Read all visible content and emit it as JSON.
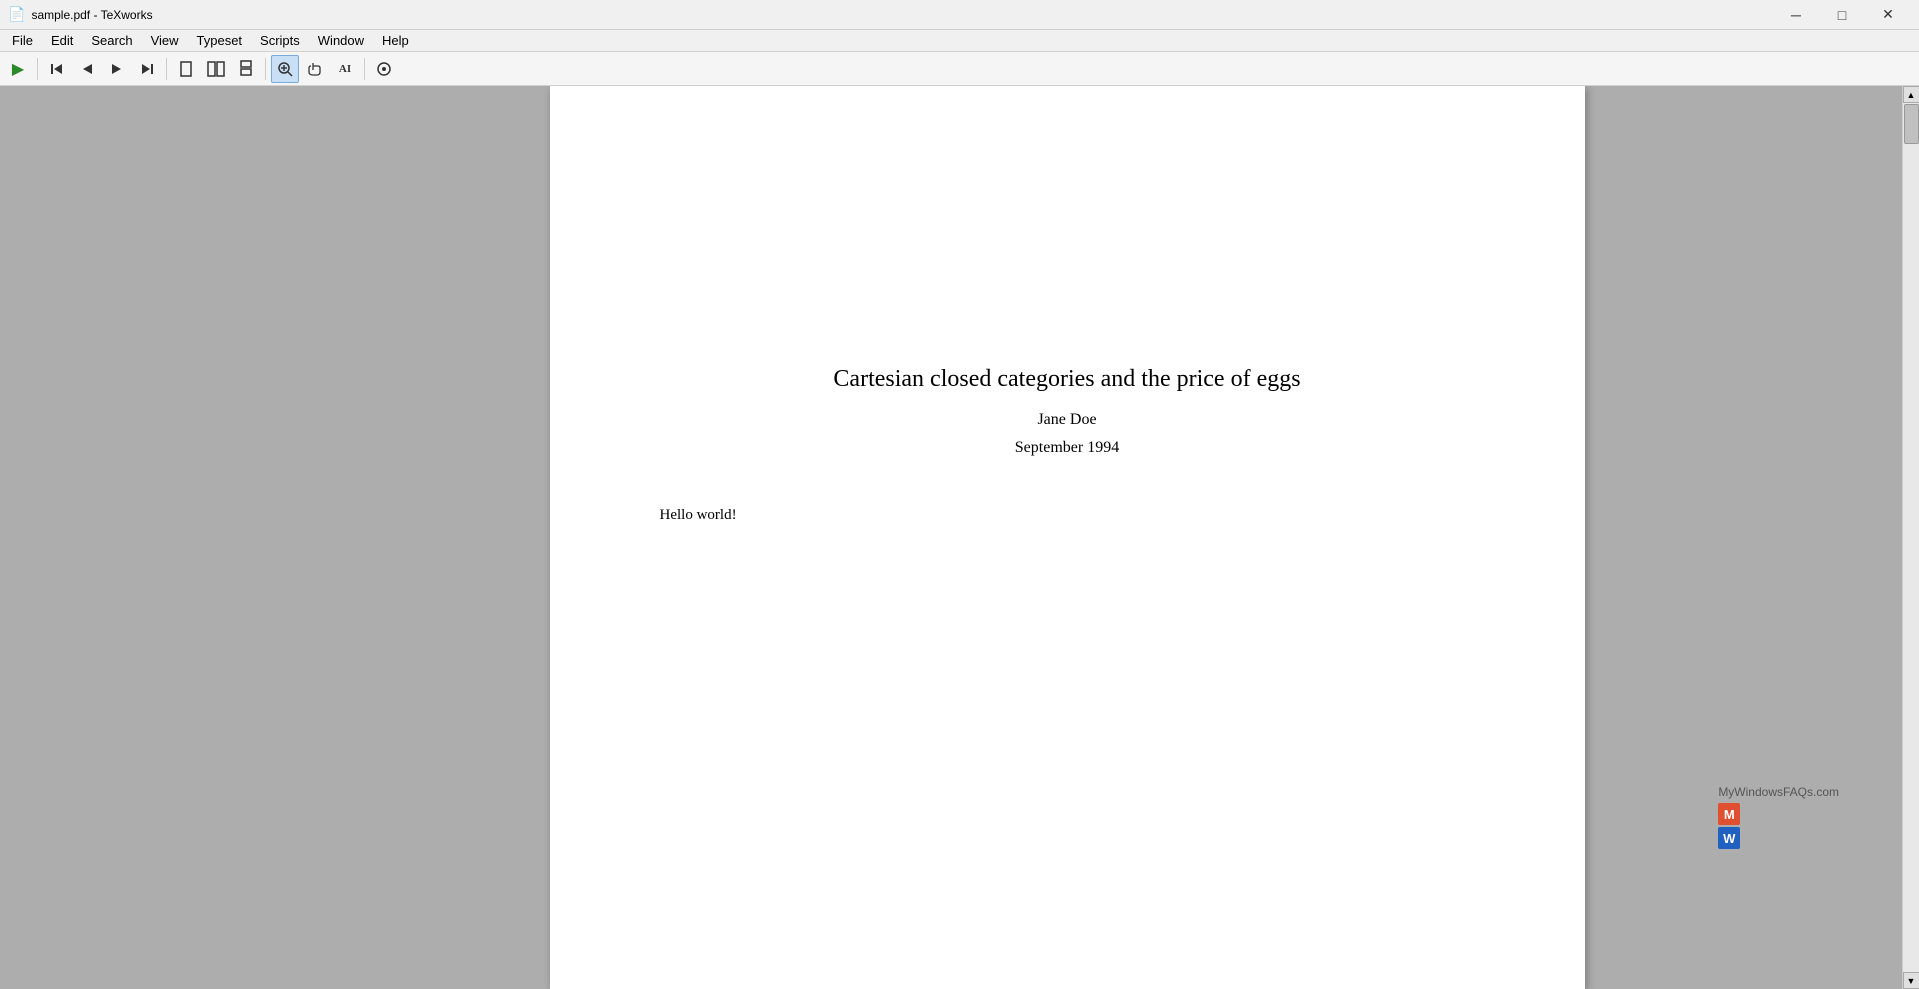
{
  "titlebar": {
    "title": "sample.pdf - TeXworks",
    "icon": "tex-icon"
  },
  "titlebar_controls": {
    "minimize": "─",
    "maximize": "□",
    "close": "✕"
  },
  "menubar": {
    "items": [
      "File",
      "Edit",
      "Search",
      "View",
      "Typeset",
      "Scripts",
      "Window",
      "Help"
    ]
  },
  "toolbar": {
    "buttons": [
      {
        "name": "play",
        "icon": "▶",
        "title": "Typeset"
      },
      {
        "name": "go-first",
        "icon": "⏮",
        "title": "First page"
      },
      {
        "name": "go-prev",
        "icon": "◀",
        "title": "Previous page"
      },
      {
        "name": "go-next",
        "icon": "▶",
        "title": "Next page"
      },
      {
        "name": "go-last",
        "icon": "⏭",
        "title": "Last page"
      },
      {
        "name": "sep1",
        "type": "separator"
      },
      {
        "name": "single-page",
        "icon": "▭",
        "title": "Single page"
      },
      {
        "name": "facing-pages",
        "icon": "▬",
        "title": "Facing pages"
      },
      {
        "name": "continuous",
        "icon": "≡",
        "title": "Continuous"
      },
      {
        "name": "sep2",
        "type": "separator"
      },
      {
        "name": "zoom-in",
        "icon": "🔍",
        "title": "Zoom in",
        "active": true
      },
      {
        "name": "hand-tool",
        "icon": "✋",
        "title": "Hand tool"
      },
      {
        "name": "text-select",
        "icon": "AI",
        "title": "Text select"
      },
      {
        "name": "sep3",
        "type": "separator"
      },
      {
        "name": "sync",
        "icon": "⊕",
        "title": "Sync"
      }
    ]
  },
  "pdf": {
    "title": "Cartesian closed categories and the price of eggs",
    "author": "Jane Doe",
    "date": "September 1994",
    "body": "Hello world!"
  },
  "watermark": {
    "text": "MyWindowsFAQs.com",
    "logo_m": "M",
    "logo_w": "W",
    "color_m": "#e05030",
    "color_w": "#2060c0",
    "color_m2": "#60b040",
    "color_w2": "#e09020"
  },
  "scrollbar": {
    "up_arrow": "▲",
    "down_arrow": "▼"
  }
}
